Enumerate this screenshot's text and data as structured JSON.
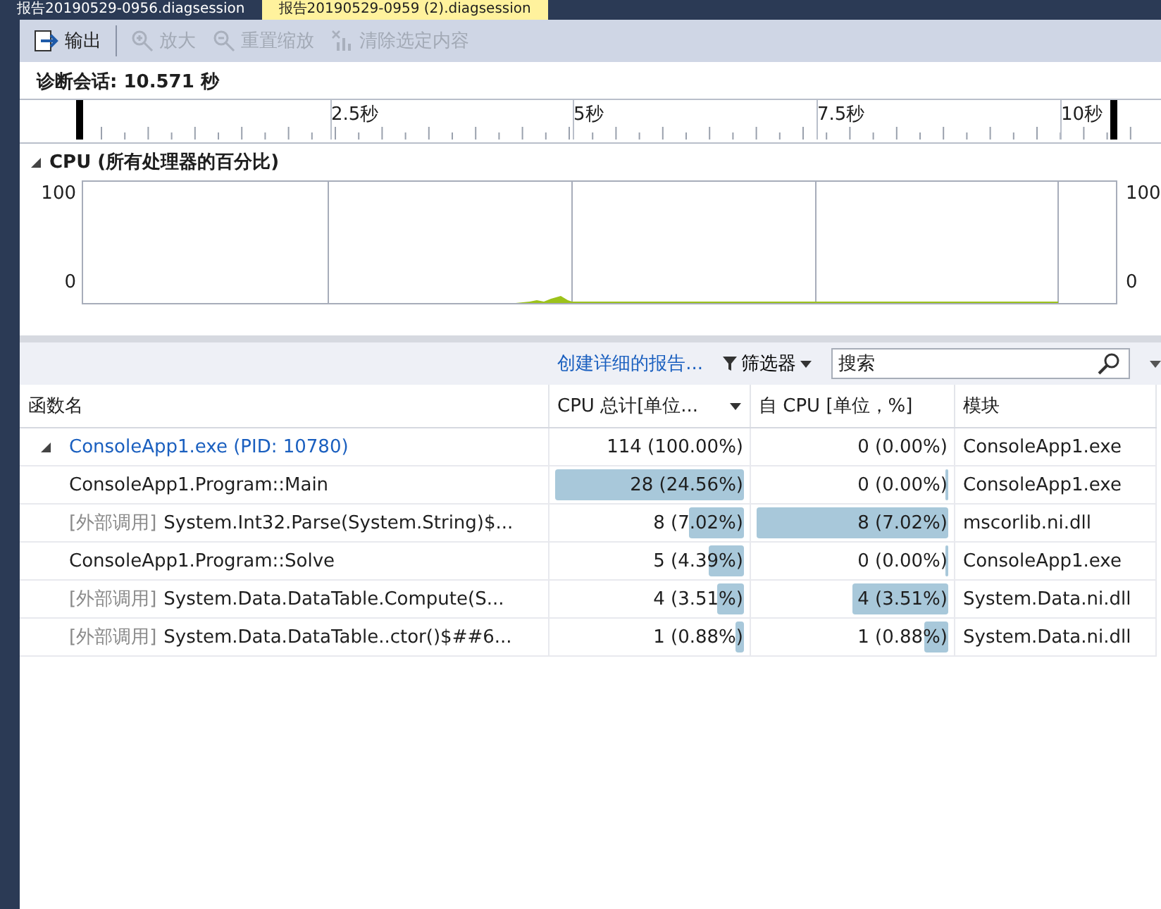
{
  "tabs": [
    {
      "label": "报告20190529-0956.diagsession",
      "selected": false
    },
    {
      "label": "报告20190529-0959 (2).diagsession",
      "selected": true
    }
  ],
  "toolbar": [
    {
      "label": "输出",
      "disabled": false
    },
    {
      "label": "放大",
      "disabled": true
    },
    {
      "label": "重置缩放",
      "disabled": true
    },
    {
      "label": "清除选定内容",
      "disabled": true
    }
  ],
  "session": {
    "label": "诊断会话: 10.571 秒"
  },
  "ruler": {
    "labels": [
      "2.5秒",
      "5秒",
      "7.5秒",
      "10秒"
    ]
  },
  "cpu": {
    "title": "CPU (所有处理器的百分比)",
    "expanded": true,
    "left_axis": [
      "100",
      "0"
    ],
    "right_axis": [
      "100",
      "0"
    ]
  },
  "report_bar": {
    "link": "创建详细的报告...",
    "filter": "筛选器",
    "search": {
      "placeholder": "搜索"
    }
  },
  "table": {
    "columns": [
      {
        "label": "函数名",
        "sorted": false
      },
      {
        "label": "CPU 总计[单位...",
        "sorted": true
      },
      {
        "label": "自 CPU [单位，%]",
        "sorted": false
      },
      {
        "label": "模块",
        "sorted": false
      }
    ],
    "rows": [
      {
        "kind": "process",
        "name": "ConsoleApp1.exe (PID: 10780)",
        "expanded": true,
        "total": "114 (100.00%)",
        "self": "0 (0.00%)",
        "module": "ConsoleApp1.exe"
      },
      {
        "kind": "function",
        "name": "ConsoleApp1.Program::Main",
        "total": "28 (24.56%)",
        "total_level": {
          "level": 1
        },
        "self": "0 (0.00%)",
        "self_level": {
          "level": 0
        },
        "module": "ConsoleApp1.exe"
      },
      {
        "kind": "external",
        "prefix": "[外部调用]",
        "name": "System.Int32.Parse(System.String)$...",
        "total": "8 (7.02%)",
        "total_level": {
          "level": 0.29
        },
        "self": "8 (7.02%)",
        "self_level": {
          "level": 1
        },
        "module": "mscorlib.ni.dll"
      },
      {
        "kind": "function",
        "name": "ConsoleApp1.Program::Solve",
        "total": "5 (4.39%)",
        "total_level": {
          "level": 0.18
        },
        "self": "0 (0.00%)",
        "self_level": {
          "level": 0
        },
        "module": "ConsoleApp1.exe"
      },
      {
        "kind": "external",
        "prefix": "[外部调用]",
        "name": "System.Data.DataTable.Compute(S...",
        "total": "4 (3.51%)",
        "total_level": {
          "level": 0.14
        },
        "self": "4 (3.51%)",
        "self_level": {
          "level": 0.5
        },
        "module": "System.Data.ni.dll"
      },
      {
        "kind": "external",
        "prefix": "[外部调用]",
        "name": "System.Data.DataTable..ctor()$##6...",
        "total": "1 (0.88%)",
        "total_level": {
          "level": 0.04
        },
        "self": "1 (0.88%)",
        "self_level": {
          "level": 0.125
        },
        "module": "System.Data.ni.dll"
      }
    ]
  }
}
